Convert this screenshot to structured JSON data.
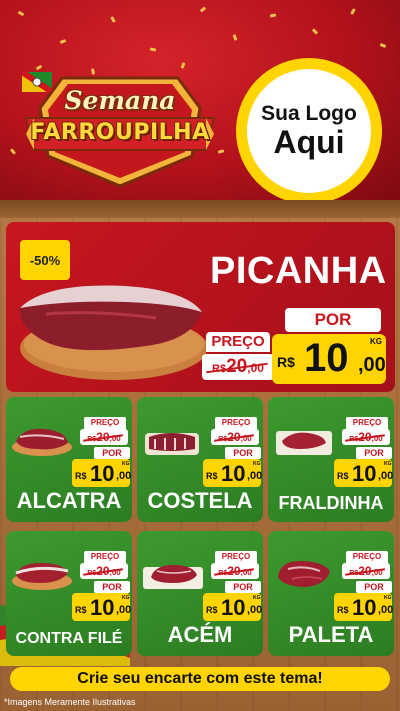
{
  "header": {
    "badge_top": "Semana",
    "badge_bottom": "FARROUPILHA",
    "logo_line1": "Sua Logo",
    "logo_line2": "Aqui"
  },
  "colors": {
    "header_red": "#b3121b",
    "featured_red": "#c8161f",
    "card_green": "#2c7d22",
    "price_yellow": "#ffd400",
    "badge_gold": "#ffd93b"
  },
  "featured": {
    "name": "PICANHA",
    "discount": "-50%",
    "old_label": "PREÇO",
    "old_currency": "R$",
    "old_integer": "20",
    "old_cents": ",00",
    "new_label": "POR",
    "new_currency": "R$",
    "new_integer": "10",
    "new_cents": ",00",
    "unit": "KG"
  },
  "products": [
    {
      "name": "ALCATRA",
      "old_label": "PREÇO",
      "old_currency": "R$",
      "old_integer": "20",
      "old_cents": ",00",
      "new_label": "POR",
      "new_currency": "R$",
      "new_integer": "10",
      "new_cents": ",00",
      "unit": "KG"
    },
    {
      "name": "COSTELA",
      "old_label": "PREÇO",
      "old_currency": "R$",
      "old_integer": "20",
      "old_cents": ",00",
      "new_label": "POR",
      "new_currency": "R$",
      "new_integer": "10",
      "new_cents": ",00",
      "unit": "KG"
    },
    {
      "name": "FRALDINHA",
      "old_label": "PREÇO",
      "old_currency": "R$",
      "old_integer": "20",
      "old_cents": ",00",
      "new_label": "POR",
      "new_currency": "R$",
      "new_integer": "10",
      "new_cents": ",00",
      "unit": "KG"
    },
    {
      "name": "CONTRA FILÉ",
      "old_label": "PREÇO",
      "old_currency": "R$",
      "old_integer": "20",
      "old_cents": ",00",
      "new_label": "POR",
      "new_currency": "R$",
      "new_integer": "10",
      "new_cents": ",00",
      "unit": "KG"
    },
    {
      "name": "ACÉM",
      "old_label": "PREÇO",
      "old_currency": "R$",
      "old_integer": "20",
      "old_cents": ",00",
      "new_label": "POR",
      "new_currency": "R$",
      "new_integer": "10",
      "new_cents": ",00",
      "unit": "KG"
    },
    {
      "name": "PALETA",
      "old_label": "PREÇO",
      "old_currency": "R$",
      "old_integer": "20",
      "old_cents": ",00",
      "new_label": "POR",
      "new_currency": "R$",
      "new_integer": "10",
      "new_cents": ",00",
      "unit": "KG"
    }
  ],
  "cta": "Crie seu encarte com este tema!",
  "disclaimer": "*Imagens Meramente Ilustrativas"
}
